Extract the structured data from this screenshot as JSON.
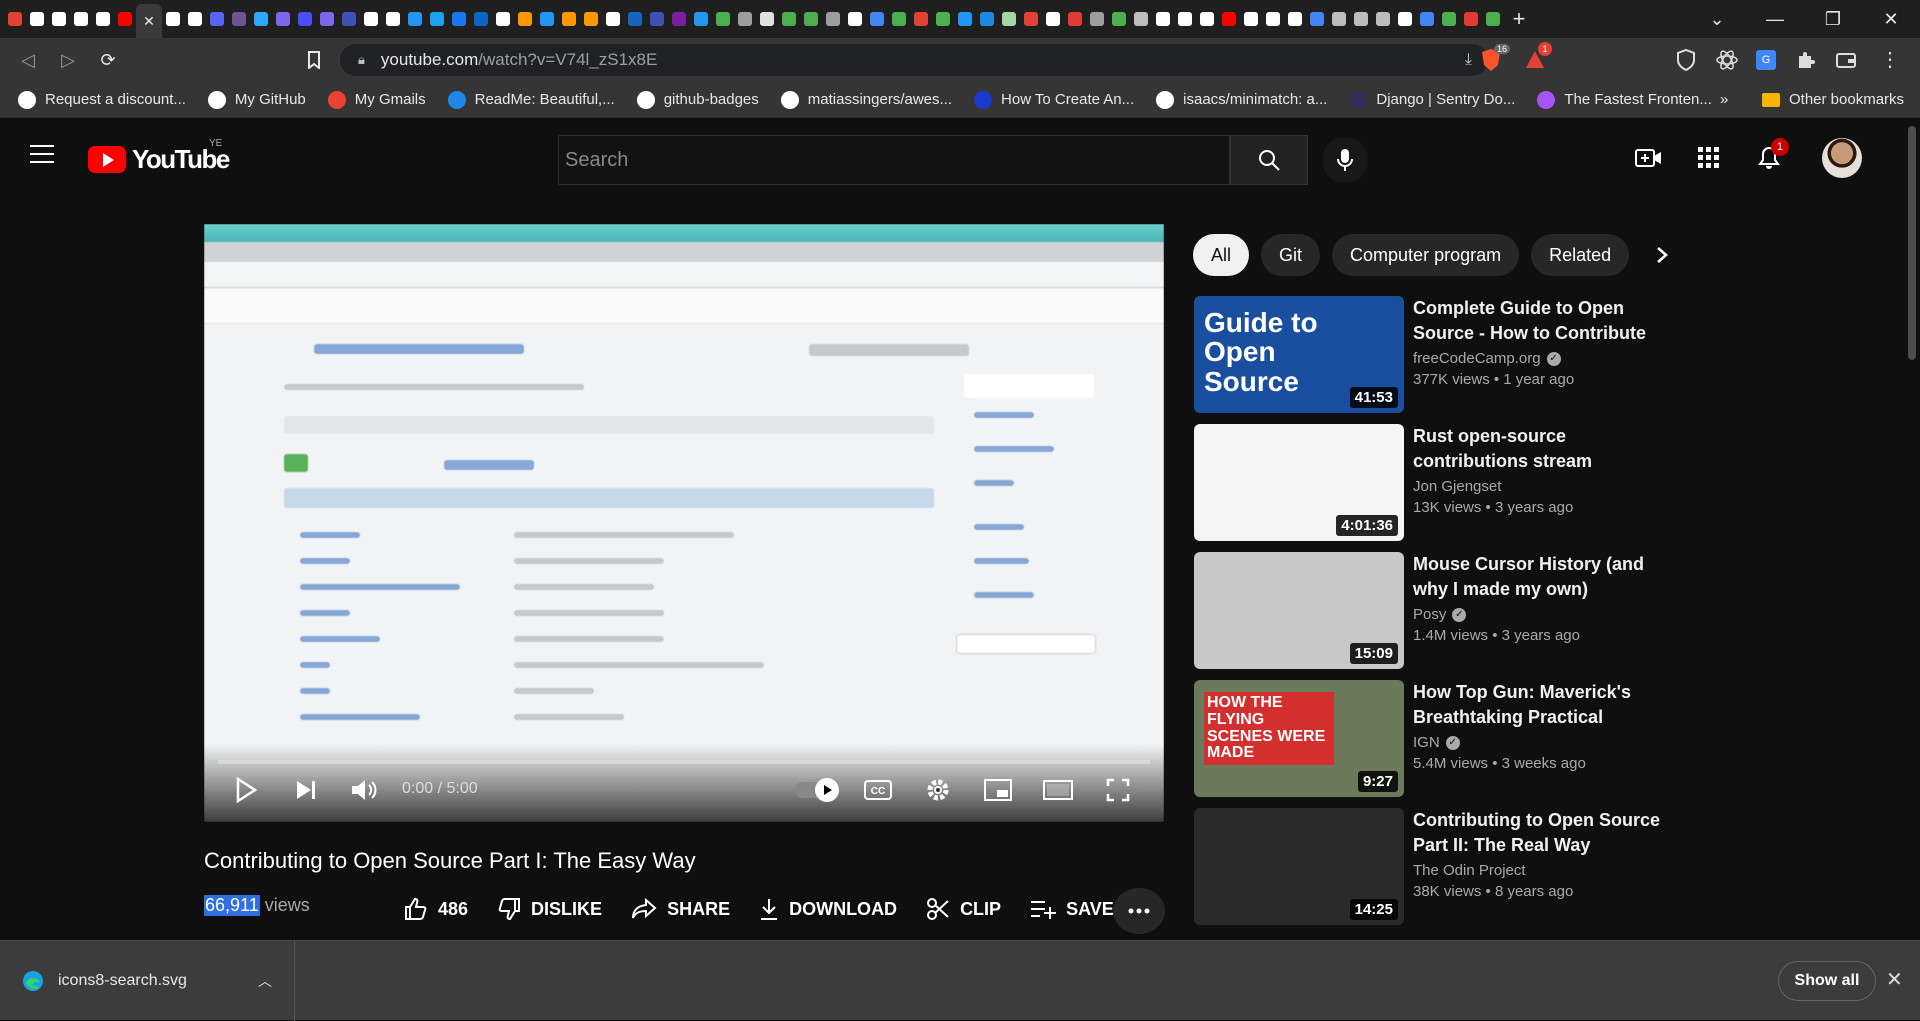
{
  "browser": {
    "url_domain": "youtube.com",
    "url_path": "/watch?v=V74l_zS1x8E",
    "tab_favicon_colors": [
      "#e34133",
      "#ffffff",
      "#ffffff",
      "#ffffff",
      "#ffffff",
      "#ff0000",
      "#ffffff",
      "#ffffff",
      "#5865f2",
      "#6e5494",
      "#2ea8ff",
      "#7b68ee",
      "#4b4bff",
      "#7b68ee",
      "#3f51b5",
      "#ffffff",
      "#ffffff",
      "#2196f3",
      "#1da1f2",
      "#1877f2",
      "#0a66c2",
      "#ffffff",
      "#ff9800",
      "#2196f3",
      "#ff9800",
      "#ff9800",
      "#ffffff",
      "#1565c0",
      "#3f51b5",
      "#7b1fa2",
      "#2196f3",
      "#4caf50",
      "#9e9e9e",
      "#e0e0e0",
      "#4caf50",
      "#4caf50",
      "#9e9e9e",
      "#ffffff",
      "#4285f4",
      "#4caf50",
      "#e34133",
      "#4caf50",
      "#2196f3",
      "#1e88e5",
      "#a5d6a7",
      "#e34133",
      "#ffffff",
      "#e53935",
      "#9e9e9e",
      "#4caf50",
      "#bdbdbd",
      "#ffffff",
      "#ffffff",
      "#ffffff",
      "#ff0000",
      "#ffffff",
      "#ffffff",
      "#ffffff",
      "#4285f4",
      "#bdbdbd",
      "#bdbdbd",
      "#bdbdbd",
      "#ffffff",
      "#4285f4",
      "#4caf50",
      "#e53935",
      "#4caf50"
    ],
    "extension_badges": {
      "brave": "16",
      "rewards": "1"
    },
    "bookmarks": [
      {
        "label": "Request a discount...",
        "icon": "github-icon",
        "color": "#ffffff"
      },
      {
        "label": "My GitHub",
        "icon": "github-icon",
        "color": "#ffffff"
      },
      {
        "label": "My Gmails",
        "icon": "gmail-icon",
        "color": "#ea4335"
      },
      {
        "label": "ReadMe: Beautiful,...",
        "icon": "readme-icon",
        "color": "#1e88e5"
      },
      {
        "label": "github-badges",
        "icon": "github-icon",
        "color": "#ffffff"
      },
      {
        "label": "matiassingers/awes...",
        "icon": "github-icon",
        "color": "#ffffff"
      },
      {
        "label": "How To Create An...",
        "icon": "js-icon",
        "color": "#1a3ccc"
      },
      {
        "label": "isaacs/minimatch: a...",
        "icon": "github-icon",
        "color": "#ffffff"
      },
      {
        "label": "Django | Sentry Do...",
        "icon": "sentry-icon",
        "color": "#362d59"
      },
      {
        "label": "The Fastest Fronten...",
        "icon": "vite-icon",
        "color": "#a855f7"
      }
    ],
    "bookmarks_overflow": "»",
    "other_bookmarks": "Other bookmarks"
  },
  "youtube": {
    "logo_text": "YouTube",
    "country_code": "YE",
    "search_placeholder": "Search",
    "notification_count": "1"
  },
  "video": {
    "time": "0:00 / 5:00",
    "title": "Contributing to Open Source Part I: The Easy Way",
    "views_number": "66,911",
    "views_label": "views",
    "actions": {
      "likes": "486",
      "dislike": "DISLIKE",
      "share": "SHARE",
      "download": "DOWNLOAD",
      "clip": "CLIP",
      "save": "SAVE"
    }
  },
  "chips": [
    "All",
    "Git",
    "Computer program",
    "Related"
  ],
  "recommendations": [
    {
      "title": "Complete Guide to Open Source - How to Contribute",
      "channel": "freeCodeCamp.org",
      "verified": true,
      "stats": "377K views • 1 year ago",
      "duration": "41:53",
      "thumb_text": "Guide to Open Source",
      "thumb_color": "#1a4fa0"
    },
    {
      "title": "Rust open-source contributions stream",
      "channel": "Jon Gjengset",
      "verified": false,
      "stats": "13K views • 3 years ago",
      "duration": "4:01:36",
      "thumb_text": "",
      "thumb_color": "#f5f5f5"
    },
    {
      "title": "Mouse Cursor History (and why I made my own)",
      "channel": "Posy",
      "verified": true,
      "stats": "1.4M views • 3 years ago",
      "duration": "15:09",
      "thumb_text": "",
      "thumb_color": "#c8c8c8"
    },
    {
      "title": "How Top Gun: Maverick's Breathtaking Practical Effects...",
      "channel": "IGN",
      "verified": true,
      "stats": "5.4M views • 3 weeks ago",
      "duration": "9:27",
      "thumb_text": "HOW THE FLYING SCENES WERE MADE",
      "thumb_color": "#6b7a5a"
    },
    {
      "title": "Contributing to Open Source Part II: The Real Way",
      "channel": "The Odin Project",
      "verified": false,
      "stats": "38K views • 8 years ago",
      "duration": "14:25",
      "thumb_text": "",
      "thumb_color": "#2a2a2a"
    }
  ],
  "downloads": {
    "filename": "icons8-search.svg",
    "show_all": "Show all"
  }
}
